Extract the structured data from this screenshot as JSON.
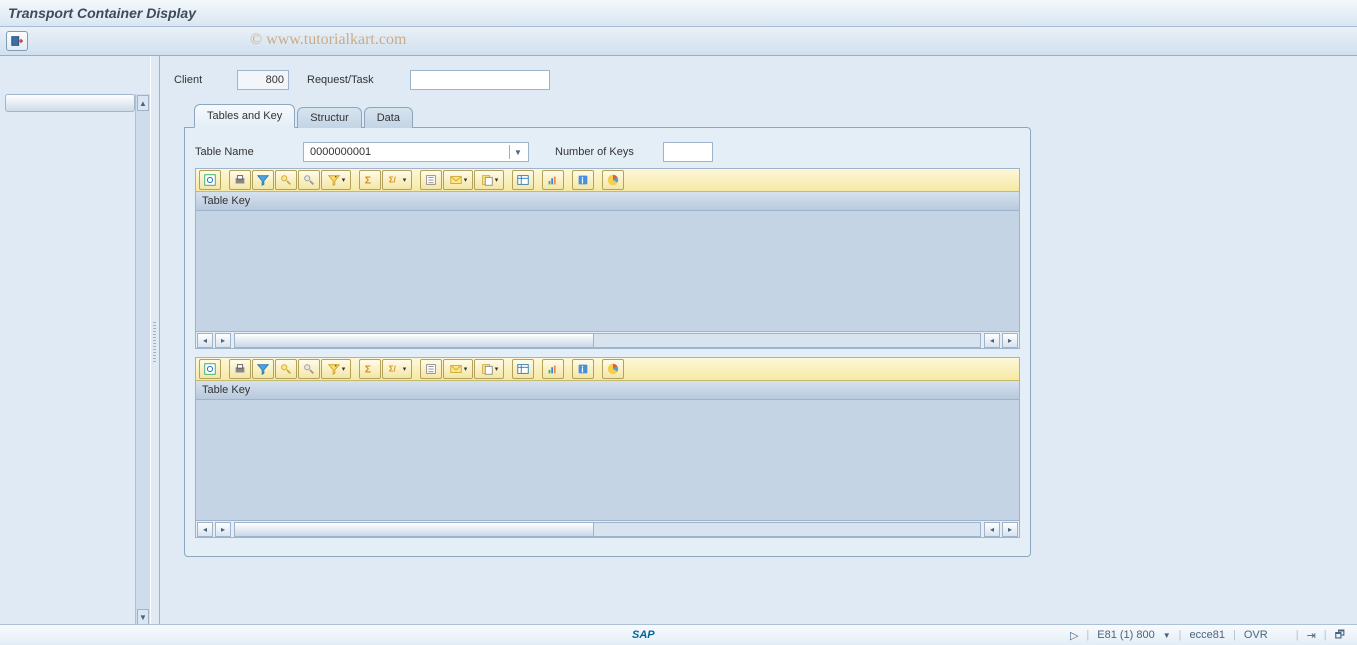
{
  "title": "Transport Container Display",
  "watermark": "© www.tutorialkart.com",
  "form": {
    "client_label": "Client",
    "client_value": "800",
    "request_label": "Request/Task",
    "request_value": ""
  },
  "tabs": [
    {
      "label": "Tables and Key",
      "active": true
    },
    {
      "label": "Structur",
      "active": false
    },
    {
      "label": "Data",
      "active": false
    }
  ],
  "panel": {
    "table_name_label": "Table Name",
    "table_name_value": "0000000001",
    "num_keys_label": "Number of Keys",
    "num_keys_value": ""
  },
  "alv_header": "Table Key",
  "toolbar_icons": [
    "details-icon",
    "gap",
    "print-icon",
    "filter-icon",
    "find-icon",
    "find-next-icon",
    "set-filter-icon",
    "gap",
    "sum-icon",
    "subtotal-icon",
    "gap",
    "export-icon",
    "send-icon",
    "attach-icon",
    "gap",
    "layout-icon",
    "gap",
    "graphic-icon",
    "gap",
    "info-icon",
    "gap",
    "chart-icon"
  ],
  "status": {
    "sap": "SAP",
    "play": "▷",
    "system": "E81 (1) 800",
    "server": "ecce81",
    "mode": "OVR"
  }
}
